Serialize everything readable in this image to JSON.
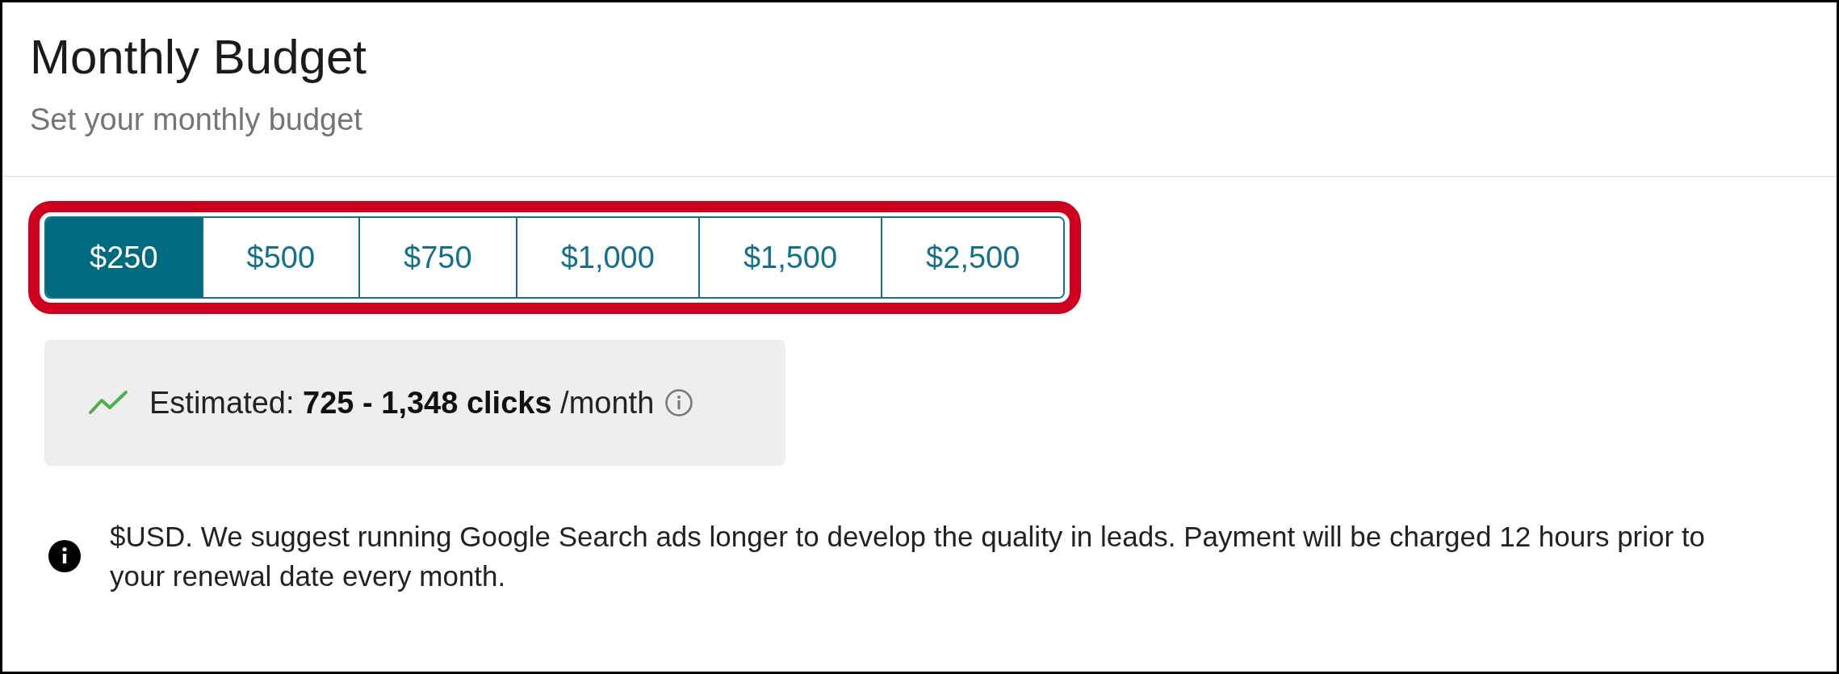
{
  "header": {
    "title": "Monthly Budget",
    "subtitle": "Set your monthly budget"
  },
  "budget_options": {
    "highlighted": true,
    "options": [
      {
        "label": "$250",
        "selected": true
      },
      {
        "label": "$500",
        "selected": false
      },
      {
        "label": "$750",
        "selected": false
      },
      {
        "label": "$1,000",
        "selected": false
      },
      {
        "label": "$1,500",
        "selected": false
      },
      {
        "label": "$2,500",
        "selected": false
      }
    ]
  },
  "estimate": {
    "text": "Estimated: **725 - 1,348 clicks** /month"
  },
  "note": {
    "text": "$USD. We suggest running Google Search ads longer to develop the quality in leads. Payment will be charged 12 hours prior to your renewal date every month."
  }
}
